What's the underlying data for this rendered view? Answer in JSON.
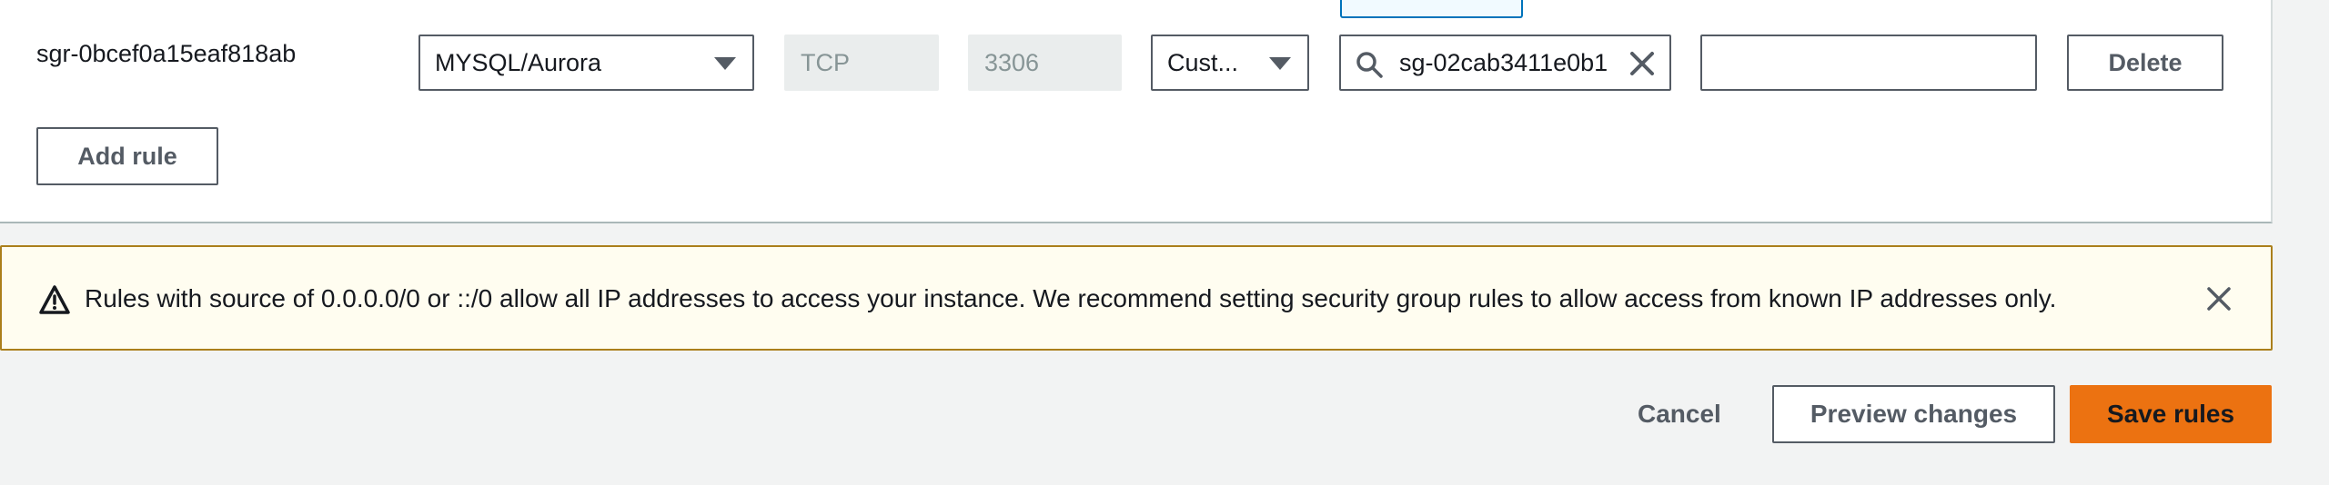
{
  "rule": {
    "id": "sgr-0bcef0a15eaf818ab",
    "type": "MYSQL/Aurora",
    "protocol": "TCP",
    "port_range": "3306",
    "source_type": "Cust...",
    "source_value": "sg-02cab3411e0b1",
    "description": "",
    "delete_label": "Delete"
  },
  "add_rule_label": "Add rule",
  "alert": {
    "message": "Rules with source of 0.0.0.0/0 or ::/0 allow all IP addresses to access your instance. We recommend setting security group rules to allow access from known IP addresses only.",
    "color": "#ab7f1b"
  },
  "footer": {
    "cancel_label": "Cancel",
    "preview_label": "Preview changes",
    "save_label": "Save rules"
  },
  "colors": {
    "primary": "#ec7211",
    "border": "#545b64",
    "focus": "#0073bb"
  },
  "icons": {
    "caret": "caret-down-icon",
    "search": "search-icon",
    "clear": "close-icon",
    "warning": "warning-icon",
    "dismiss": "close-icon"
  }
}
